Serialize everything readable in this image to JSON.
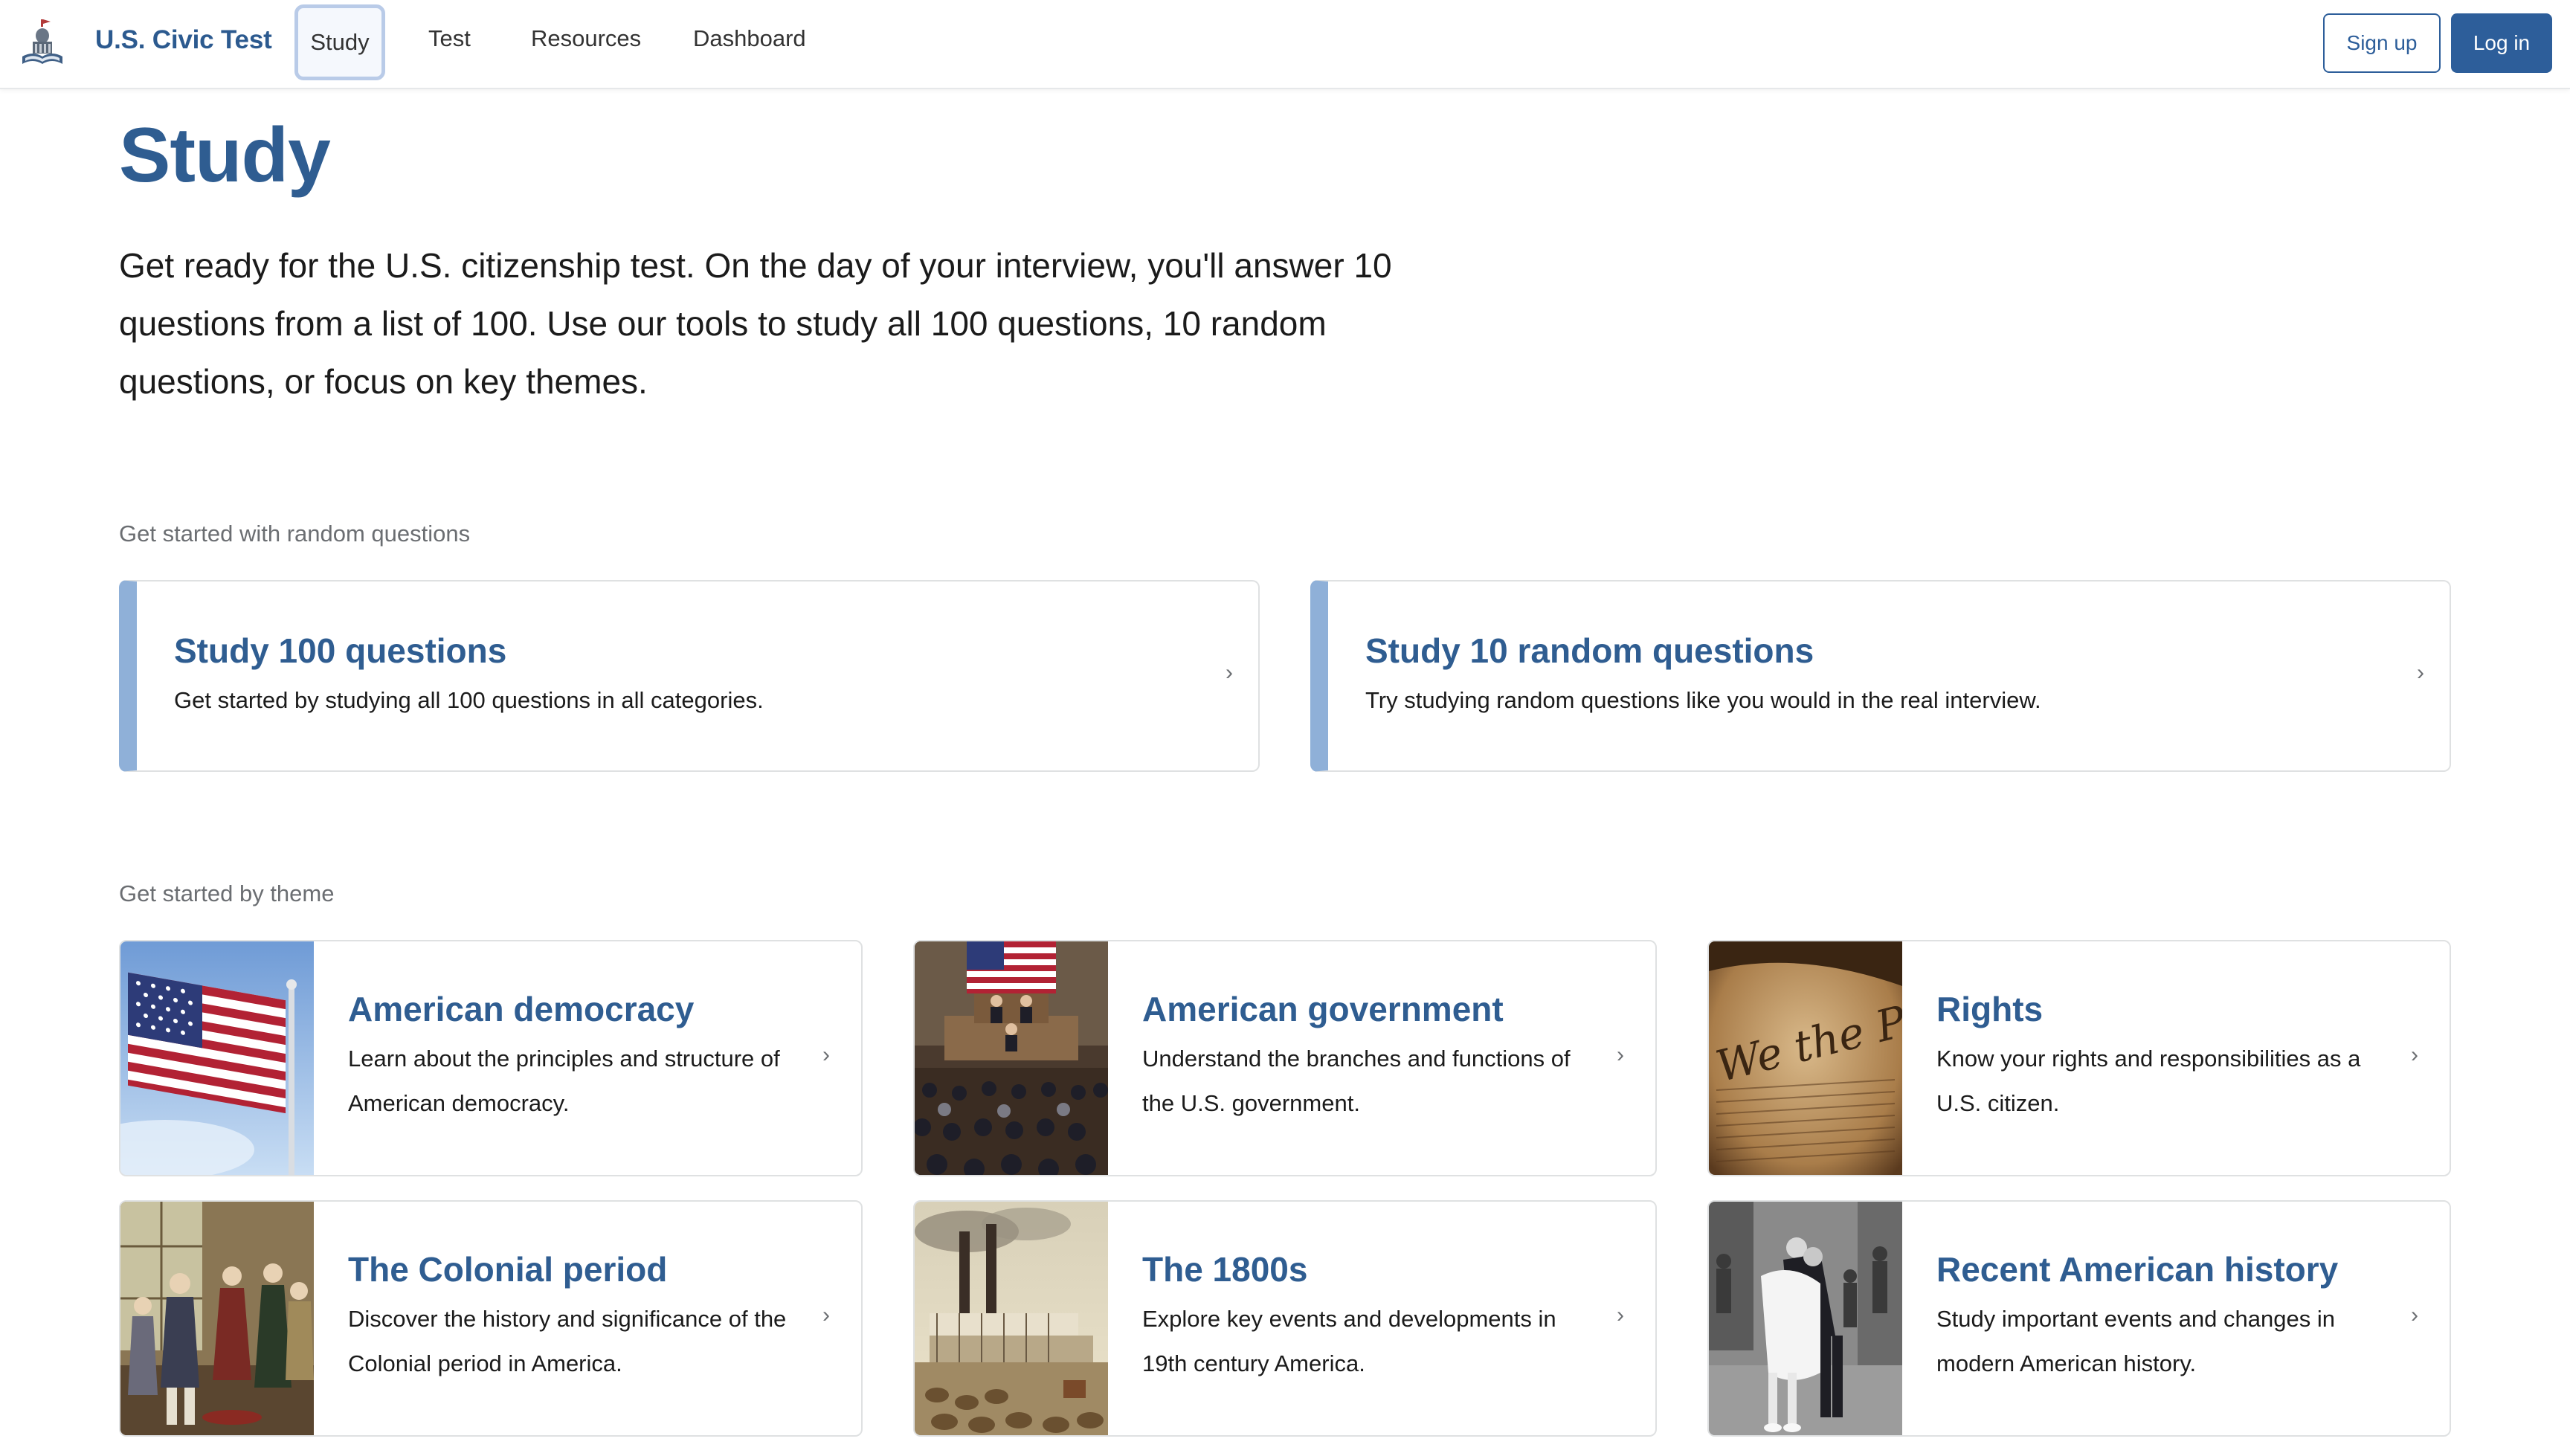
{
  "header": {
    "brand": "U.S. Civic Test",
    "nav": {
      "study": "Study",
      "test": "Test",
      "resources": "Resources",
      "dashboard": "Dashboard"
    },
    "signup_label": "Sign up",
    "login_label": "Log in"
  },
  "main": {
    "title": "Study",
    "intro": "Get ready for the U.S. citizenship test. On the day of your interview, you'll answer 10 questions from a list of 100. Use our tools to study all 100 questions, 10 random questions, or focus on key themes.",
    "random_section_label": "Get started with random questions",
    "random_cards": [
      {
        "title": "Study 100 questions",
        "desc": "Get started by studying all 100 questions in all categories."
      },
      {
        "title": "Study 10 random questions",
        "desc": "Try studying random questions like you would in the real interview."
      }
    ],
    "theme_section_label": "Get started by theme",
    "themes": [
      {
        "title": "American democracy",
        "desc": "Learn about the principles and structure of American democracy."
      },
      {
        "title": "American government",
        "desc": "Understand the branches and functions of the U.S. government."
      },
      {
        "title": "Rights",
        "desc": "Know your rights and responsibilities as a U.S. citizen."
      },
      {
        "title": "The Colonial period",
        "desc": "Discover the history and significance of the Colonial period in America."
      },
      {
        "title": "The 1800s",
        "desc": "Explore key events and developments in 19th century America."
      },
      {
        "title": "Recent American history",
        "desc": "Study important events and changes in modern American history."
      }
    ],
    "chevron": "›"
  },
  "colors": {
    "brand": "#2c5a8f",
    "primary_button": "#2d5e9a",
    "card_accent": "#8fb0d8",
    "muted_text": "#6b6e72"
  },
  "icons": {
    "logo": "capitol-book-icon",
    "chevron": "chevron-right-icon"
  }
}
